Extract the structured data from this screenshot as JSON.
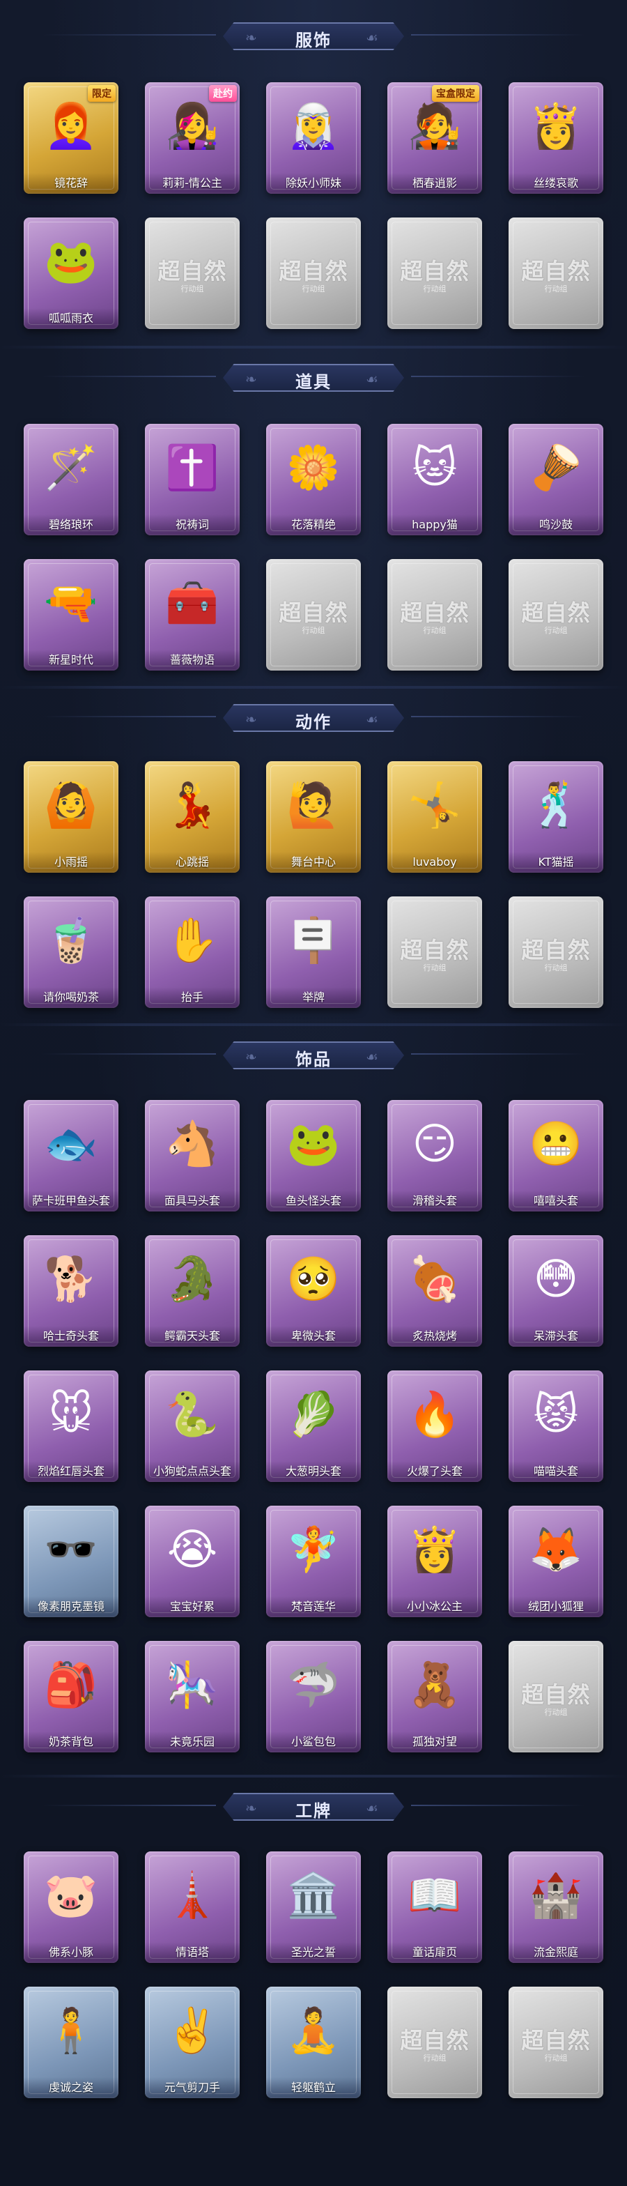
{
  "sections": [
    {
      "title": "服饰",
      "rows": [
        [
          {
            "label": "镜花辞",
            "style": "gold",
            "icon": "👩‍🦰",
            "icon_name": "red-hood-girl-icon",
            "badge": "限定",
            "badge_style": "gold"
          },
          {
            "label": "莉莉-情公主",
            "style": "purple",
            "icon": "👩‍🎤",
            "icon_name": "pink-hair-girl-icon",
            "badge": "赴约",
            "badge_style": "pink"
          },
          {
            "label": "除妖小师妹",
            "style": "purple",
            "icon": "🧝‍♀️",
            "icon_name": "silver-hair-girl-icon"
          },
          {
            "label": "栖春逍影",
            "style": "purple",
            "icon": "🧑‍🎤",
            "icon_name": "swordsman-icon",
            "badge": "宝盒限定",
            "badge_style": "gold"
          },
          {
            "label": "丝缕哀歌",
            "style": "purple",
            "icon": "👸",
            "icon_name": "flower-girl-icon"
          }
        ],
        [
          {
            "label": "呱呱雨衣",
            "style": "purple",
            "icon": "🐸",
            "icon_name": "frog-raincoat-icon"
          },
          {
            "placeholder": true
          },
          {
            "placeholder": true
          },
          {
            "placeholder": true
          },
          {
            "placeholder": true
          }
        ]
      ]
    },
    {
      "title": "道具",
      "rows": [
        [
          {
            "label": "碧络琅环",
            "style": "purple",
            "icon": "🪄",
            "icon_name": "jade-staff-icon"
          },
          {
            "label": "祝祷词",
            "style": "purple",
            "icon": "✝️",
            "icon_name": "gold-cross-icon"
          },
          {
            "label": "花落精绝",
            "style": "purple",
            "icon": "🌼",
            "icon_name": "flower-pendant-icon"
          },
          {
            "label": "happy猫",
            "style": "purple",
            "icon": "🐱",
            "icon_name": "happy-cat-icon"
          },
          {
            "label": "鸣沙鼓",
            "style": "purple",
            "icon": "🪘",
            "icon_name": "drum-icon"
          }
        ],
        [
          {
            "label": "新星时代",
            "style": "purple",
            "icon": "🔫",
            "icon_name": "revolver-icon"
          },
          {
            "label": "蔷薇物语",
            "style": "purple",
            "icon": "🧰",
            "icon_name": "medical-box-icon"
          },
          {
            "placeholder": true
          },
          {
            "placeholder": true
          },
          {
            "placeholder": true
          }
        ]
      ]
    },
    {
      "title": "动作",
      "rows": [
        [
          {
            "label": "小雨摇",
            "style": "gold",
            "icon": "🙆",
            "icon_name": "pose-icon"
          },
          {
            "label": "心跳摇",
            "style": "gold",
            "icon": "💃",
            "icon_name": "dance-icon"
          },
          {
            "label": "舞台中心",
            "style": "gold",
            "icon": "🙋",
            "icon_name": "stage-icon"
          },
          {
            "label": "luvaboy",
            "style": "gold",
            "icon": "🤸",
            "icon_name": "pose-icon"
          },
          {
            "label": "KT猫摇",
            "style": "purple",
            "icon": "🕺",
            "icon_name": "cat-dance-icon"
          }
        ],
        [
          {
            "label": "请你喝奶茶",
            "style": "purple",
            "icon": "🧋",
            "icon_name": "milk-tea-icon"
          },
          {
            "label": "抬手",
            "style": "purple",
            "icon": "✋",
            "icon_name": "raise-hand-icon"
          },
          {
            "label": "举牌",
            "style": "purple",
            "icon": "🪧",
            "icon_name": "sign-icon"
          },
          {
            "placeholder": true
          },
          {
            "placeholder": true
          }
        ]
      ]
    },
    {
      "title": "饰品",
      "rows": [
        [
          {
            "label": "萨卡班甲鱼头套",
            "style": "purple",
            "icon": "🐟",
            "icon_name": "fish-head-icon"
          },
          {
            "label": "面具马头套",
            "style": "purple",
            "icon": "🐴",
            "icon_name": "horse-head-icon"
          },
          {
            "label": "鱼头怪头套",
            "style": "purple",
            "icon": "🐸",
            "icon_name": "fish-monster-icon"
          },
          {
            "label": "滑稽头套",
            "style": "purple",
            "icon": "😏",
            "icon_name": "funny-face-icon"
          },
          {
            "label": "嘻嘻头套",
            "style": "purple",
            "icon": "😬",
            "icon_name": "grin-face-icon"
          }
        ],
        [
          {
            "label": "哈士奇头套",
            "style": "purple",
            "icon": "🐕",
            "icon_name": "husky-head-icon"
          },
          {
            "label": "鳄霸天头套",
            "style": "purple",
            "icon": "🐊",
            "icon_name": "crocodile-head-icon"
          },
          {
            "label": "卑微头套",
            "style": "purple",
            "icon": "🥺",
            "icon_name": "sad-face-icon"
          },
          {
            "label": "炙热烧烤",
            "style": "purple",
            "icon": "🍖",
            "icon_name": "bbq-icon"
          },
          {
            "label": "呆滞头套",
            "style": "purple",
            "icon": "😳",
            "icon_name": "blank-face-icon"
          }
        ],
        [
          {
            "label": "烈焰红唇头套",
            "style": "purple",
            "icon": "🐭",
            "icon_name": "pikachu-head-icon"
          },
          {
            "label": "小狗蛇点点头套",
            "style": "purple",
            "icon": "🐍",
            "icon_name": "snake-head-icon"
          },
          {
            "label": "大葱明头套",
            "style": "purple",
            "icon": "🥬",
            "icon_name": "scallion-head-icon"
          },
          {
            "label": "火爆了头套",
            "style": "purple",
            "icon": "🔥",
            "icon_name": "fire-head-icon"
          },
          {
            "label": "喵喵头套",
            "style": "purple",
            "icon": "😾",
            "icon_name": "cat-head-icon"
          }
        ],
        [
          {
            "label": "像素朋克墨镜",
            "style": "blue",
            "icon": "🕶️",
            "icon_name": "pixel-sunglasses-icon"
          },
          {
            "label": "宝宝好累",
            "style": "purple",
            "icon": "😭",
            "icon_name": "tired-baby-icon"
          },
          {
            "label": "梵音莲华",
            "style": "purple",
            "icon": "🧚",
            "icon_name": "lotus-fairy-icon"
          },
          {
            "label": "小小冰公主",
            "style": "purple",
            "icon": "👸",
            "icon_name": "ice-princess-icon"
          },
          {
            "label": "绒团小狐狸",
            "style": "purple",
            "icon": "🦊",
            "icon_name": "fox-icon"
          }
        ],
        [
          {
            "label": "奶茶背包",
            "style": "purple",
            "icon": "🎒",
            "icon_name": "milk-tea-backpack-icon"
          },
          {
            "label": "未竟乐园",
            "style": "purple",
            "icon": "🎠",
            "icon_name": "paradise-icon"
          },
          {
            "label": "小鲨包包",
            "style": "purple",
            "icon": "🦈",
            "icon_name": "shark-bag-icon"
          },
          {
            "label": "孤独对望",
            "style": "purple",
            "icon": "🧸",
            "icon_name": "lonely-doll-icon"
          },
          {
            "placeholder": true
          }
        ]
      ]
    },
    {
      "title": "工牌",
      "rows": [
        [
          {
            "label": "佛系小豚",
            "style": "purple",
            "icon": "🐷",
            "icon_name": "buddha-pig-card-icon"
          },
          {
            "label": "情语塔",
            "style": "purple",
            "icon": "🗼",
            "icon_name": "tower-card-icon"
          },
          {
            "label": "圣光之誓",
            "style": "purple",
            "icon": "🏛️",
            "icon_name": "holy-light-card-icon"
          },
          {
            "label": "童话扉页",
            "style": "purple",
            "icon": "📖",
            "icon_name": "fairy-tale-card-icon"
          },
          {
            "label": "流金熙庭",
            "style": "purple",
            "icon": "🏰",
            "icon_name": "golden-court-card-icon"
          }
        ],
        [
          {
            "label": "虔诚之姿",
            "style": "blue",
            "icon": "🧍",
            "icon_name": "silhouette-card-icon"
          },
          {
            "label": "元气剪刀手",
            "style": "blue",
            "icon": "✌️",
            "icon_name": "peace-sign-card-icon"
          },
          {
            "label": "轻躯鹤立",
            "style": "blue",
            "icon": "🧘",
            "icon_name": "crane-pose-card-icon"
          },
          {
            "placeholder": true
          },
          {
            "placeholder": true
          }
        ]
      ]
    }
  ],
  "placeholder": {
    "logo": "超自然",
    "sub": "行动组"
  },
  "colors": {
    "background": "#0f1525",
    "banner": "#1f2a4c",
    "purple_card": "#8f5fae",
    "gold_card": "#d5a637",
    "gray_card": "#bcbcbc",
    "blue_card": "#7d97b8"
  }
}
